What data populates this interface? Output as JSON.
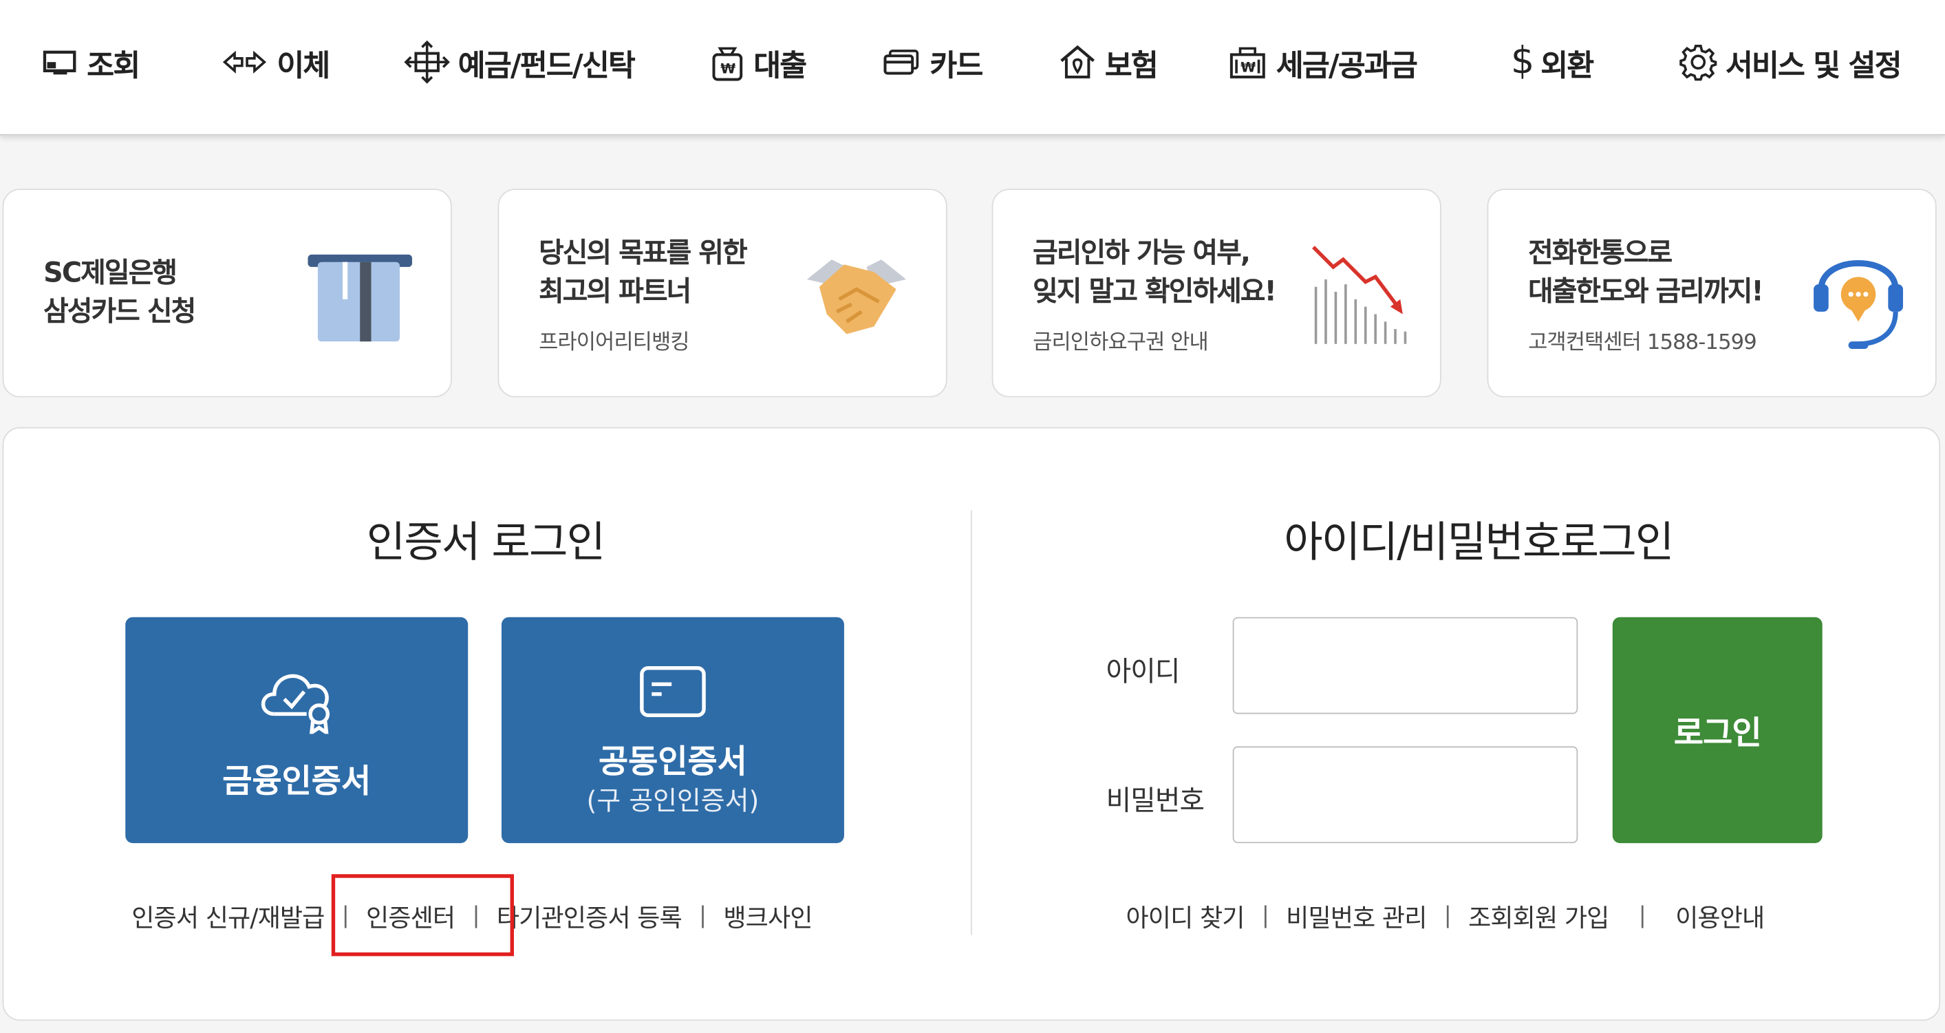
{
  "nav": {
    "items": [
      {
        "label": "조회",
        "icon": "monitor-icon"
      },
      {
        "label": "이체",
        "icon": "transfer-arrows-icon"
      },
      {
        "label": "예금/펀드/신탁",
        "icon": "deposit-move-icon"
      },
      {
        "label": "대출",
        "icon": "loan-bag-icon"
      },
      {
        "label": "카드",
        "icon": "card-icon"
      },
      {
        "label": "보험",
        "icon": "house-shield-icon"
      },
      {
        "label": "세금/공과금",
        "icon": "tax-building-icon"
      },
      {
        "label": "외환",
        "icon": "dollar-icon"
      },
      {
        "label": "서비스 및 설정",
        "icon": "gear-icon"
      }
    ]
  },
  "banners": [
    {
      "title": "SC제일은행\n삼성카드 신청",
      "sub": "",
      "icon": "card-slot-icon"
    },
    {
      "title": "당신의 목표를 위한\n최고의 파트너",
      "sub": "프라이어리티뱅킹",
      "icon": "handshake-icon"
    },
    {
      "title": "금리인하 가능 여부,\n잊지 말고 확인하세요!",
      "sub": "금리인하요구권 안내",
      "icon": "falling-chart-icon"
    },
    {
      "title": "전화한통으로\n대출한도와 금리까지!",
      "sub": "고객컨택센터 1588-1599",
      "icon": "headset-icon"
    }
  ],
  "cert_login": {
    "title": "인증서 로그인",
    "financial_cert": {
      "label": "금융인증서",
      "icon": "cloud-cert-icon"
    },
    "joint_cert": {
      "label": "공동인증서",
      "sub": "(구 공인인증서)",
      "icon": "card-outline-icon"
    },
    "links": [
      {
        "label": "인증서 신규/재발급"
      },
      {
        "label": "인증센터"
      },
      {
        "label": "타기관인증서 등록"
      },
      {
        "label": "뱅크사인"
      }
    ],
    "separator": "|"
  },
  "id_login": {
    "title": "아이디/비밀번호로그인",
    "id_label": "아이디",
    "pw_label": "비밀번호",
    "id_value": "",
    "pw_value": "",
    "login_button": "로그인",
    "links": [
      {
        "label": "아이디 찾기"
      },
      {
        "label": "비밀번호 관리"
      },
      {
        "label": "조회회원 가입"
      },
      {
        "label": "이용안내"
      }
    ],
    "separator": "|"
  },
  "colors": {
    "cert_button": "#2e6ca8",
    "login_button": "#3e8b38",
    "highlight": "#e12020"
  }
}
